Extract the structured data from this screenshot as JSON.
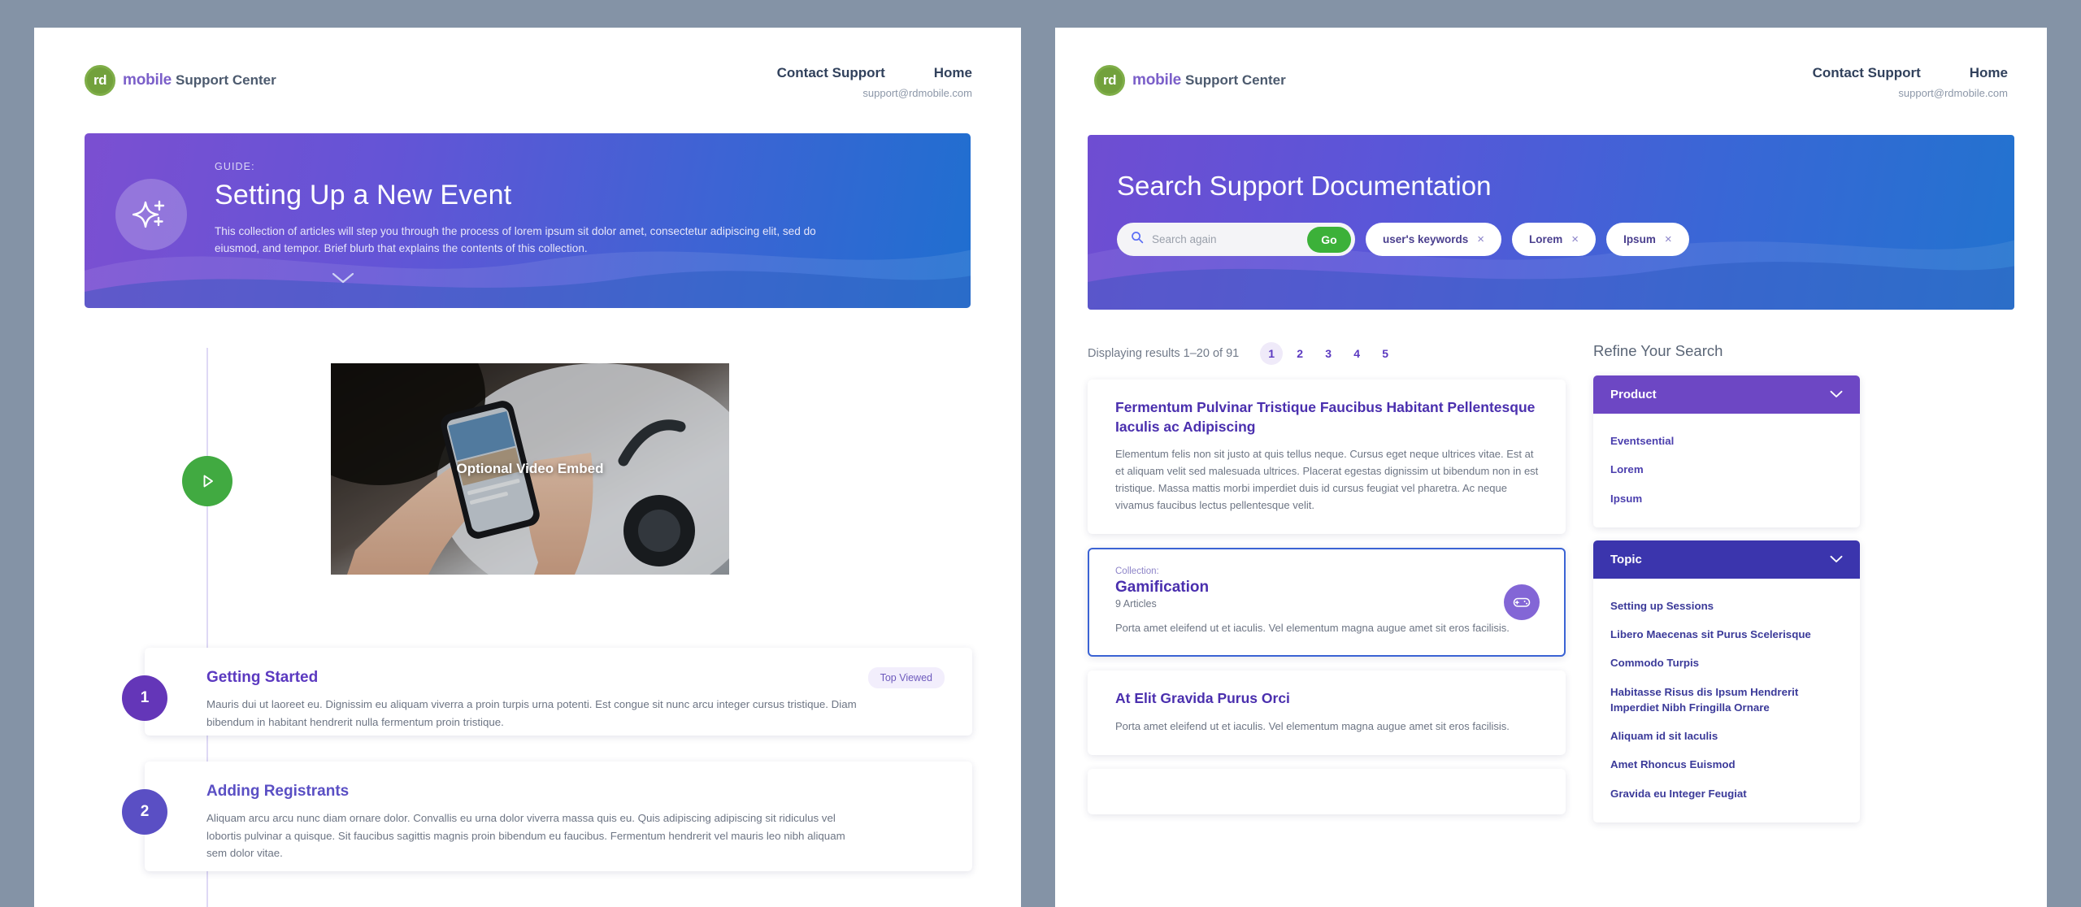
{
  "header": {
    "brand_mark": "rd",
    "brand_word": "mobile",
    "brand_rest": "Support Center",
    "nav": [
      {
        "label": "Contact Support",
        "sub": "support@rdmobile.com"
      },
      {
        "label": "Home",
        "sub": ""
      }
    ]
  },
  "left": {
    "hero": {
      "eyebrow": "GUIDE:",
      "title": "Setting Up a New Event",
      "description": "This collection of articles will step you through the process of lorem ipsum sit dolor amet, consectetur adipiscing elit, sed do eiusmod, and tempor. Brief blurb that explains the contents of this collection.",
      "icon": "sparkle-icon",
      "chevron": "chevron-down-icon"
    },
    "video": {
      "label": "Optional Video Embed",
      "play_icon": "play-icon"
    },
    "steps": [
      {
        "number": "1",
        "title": "Getting Started",
        "badge": "Top Viewed",
        "description": "Mauris dui ut laoreet eu. Dignissim eu aliquam viverra a proin turpis urna potenti. Est congue sit nunc arcu integer cursus tristique. Diam bibendum in habitant hendrerit nulla fermentum proin tristique."
      },
      {
        "number": "2",
        "title": "Adding Registrants",
        "badge": "",
        "description": "Aliquam arcu arcu nunc diam ornare dolor. Convallis eu urna dolor viverra massa quis eu. Quis adipiscing adipiscing sit ridiculus vel lobortis pulvinar a quisque. Sit faucibus sagittis magnis proin bibendum eu faucibus. Fermentum hendrerit vel mauris leo nibh aliquam sem dolor vitae."
      }
    ]
  },
  "right": {
    "hero": {
      "title": "Search Support Documentation",
      "search_placeholder": "Search again",
      "search_value": "",
      "go_label": "Go",
      "search_icon": "search-icon",
      "chips": [
        {
          "label": "user's keywords",
          "remove": "×"
        },
        {
          "label": "Lorem",
          "remove": "×"
        },
        {
          "label": "Ipsum",
          "remove": "×"
        }
      ]
    },
    "results": {
      "count_text": "Displaying results 1–20 of 91",
      "pages": [
        "1",
        "2",
        "3",
        "4",
        "5"
      ],
      "active_page": "1",
      "cards": [
        {
          "type": "article",
          "title": "Fermentum Pulvinar Tristique Faucibus Habitant Pellentesque Iaculis ac Adipiscing",
          "description": "Elementum felis non sit justo at quis tellus neque. Cursus eget neque ultrices vitae. Est at et aliquam velit sed malesuada ultrices. Placerat egestas dignissim ut bibendum non in est tristique. Massa mattis morbi imperdiet duis id cursus feugiat vel pharetra. Ac neque vivamus faucibus lectus pellentesque velit."
        },
        {
          "type": "collection",
          "eyebrow": "Collection:",
          "title": "Gamification",
          "sub": "9 Articles",
          "description": "Porta amet eleifend ut et iaculis. Vel elementum magna augue amet sit eros facilisis.",
          "icon": "gamepad-icon"
        },
        {
          "type": "article",
          "title": "At Elit Gravida Purus Orci",
          "description": "Porta amet eleifend ut et iaculis. Vel elementum magna augue amet sit eros facilisis."
        }
      ]
    },
    "refine": {
      "title": "Refine Your Search",
      "facets": [
        {
          "name": "Product",
          "chevron": "chevron-down-icon",
          "options": [
            "Eventsential",
            "Lorem",
            "Ipsum"
          ]
        },
        {
          "name": "Topic",
          "chevron": "chevron-down-icon",
          "options": [
            "Setting up Sessions",
            "Libero Maecenas sit Purus Scelerisque",
            "Commodo Turpis",
            "Habitasse Risus dis Ipsum Hendrerit Imperdiet Nibh Fringilla Ornare",
            "Aliquam id sit Iaculis",
            "Amet Rhoncus Euismod",
            "Gravida eu Integer Feugiat"
          ]
        }
      ]
    }
  },
  "colors": {
    "brand_green": "#72a13c",
    "purple": "#6436b8",
    "indigo": "#3b35ad",
    "go_green": "#3cb139",
    "page_bg": "#8493a6"
  }
}
